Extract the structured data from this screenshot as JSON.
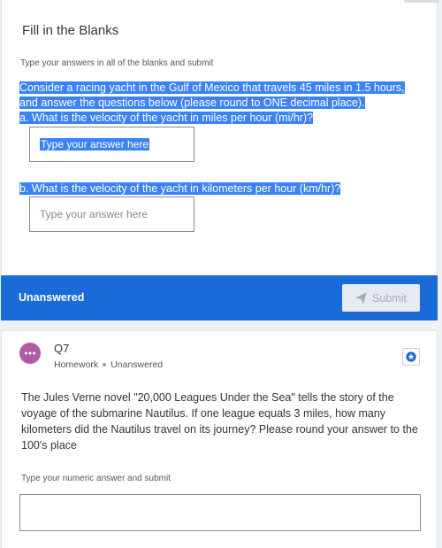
{
  "card1": {
    "title": "Fill in the Blanks",
    "instruction": "Type your answers in all of the blanks and submit",
    "question_lines": [
      "Consider a racing yacht in the Gulf of Mexico that travels 45 miles in 1.5 hours,",
      "and answer the questions below (please round to ONE decimal place).",
      "a.  What is the velocity of the yacht in miles per hour (mi/hr)?"
    ],
    "answer_a_placeholder": "Type your answer here",
    "question_b": "b.  What is the velocity of the yacht in kilometers per hour (km/hr)?",
    "answer_b_placeholder": "Type your answer here",
    "status": "Unanswered",
    "submit_label": "Submit"
  },
  "card2": {
    "avatar_glyph": "···",
    "number": "Q7",
    "type": "Homework",
    "status": "Unanswered",
    "question": "The Jules Verne novel \"20,000 Leagues Under the Sea\" tells the story of the voyage of the submarine Nautilus. If one league equals 3 miles, how many kilometers did the Nautilus travel on its journey? Please round your answer to the 100's place",
    "instruction": "Type your numeric answer and submit",
    "answer_value": ""
  },
  "icons": {
    "submit": "paper-plane-icon",
    "avatar": "chat-bubble-icon",
    "star": "star-icon"
  },
  "colors": {
    "accent": "#1a6bd8",
    "selection": "#3b82f6",
    "avatar": "#b15ba6"
  }
}
